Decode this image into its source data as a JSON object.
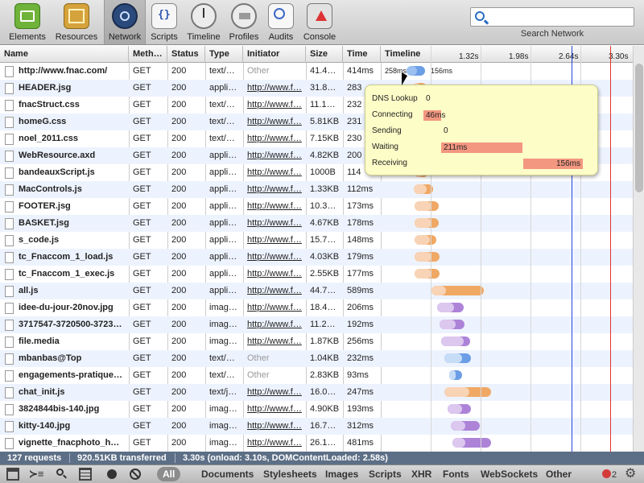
{
  "toolbar": {
    "tools": [
      "Elements",
      "Resources",
      "Network",
      "Scripts",
      "Timeline",
      "Profiles",
      "Audits",
      "Console"
    ],
    "selected": "Network"
  },
  "search": {
    "label": "Search Network",
    "value": ""
  },
  "columns": [
    "Name",
    "Meth…",
    "Status",
    "Type",
    "Initiator",
    "Size",
    "Time",
    "Timeline"
  ],
  "timeline_ticks": [
    "1.32s",
    "1.98s",
    "2.64s",
    "3.30s"
  ],
  "rows": [
    {
      "name": "http://www.fnac.com/",
      "method": "GET",
      "status": "200",
      "type": "text/…",
      "initiator": "Other",
      "size": "41.4…",
      "time": "414ms"
    },
    {
      "name": "HEADER.jsg",
      "method": "GET",
      "status": "200",
      "type": "appli…",
      "initiator": "http://www.f…",
      "size": "31.8…",
      "time": "283"
    },
    {
      "name": "fnacStruct.css",
      "method": "GET",
      "status": "200",
      "type": "text/…",
      "initiator": "http://www.f…",
      "size": "11.1…",
      "time": "232"
    },
    {
      "name": "homeG.css",
      "method": "GET",
      "status": "200",
      "type": "text/…",
      "initiator": "http://www.f…",
      "size": "5.81KB",
      "time": "231"
    },
    {
      "name": "noel_2011.css",
      "method": "GET",
      "status": "200",
      "type": "text/…",
      "initiator": "http://www.f…",
      "size": "7.15KB",
      "time": "230"
    },
    {
      "name": "WebResource.axd",
      "method": "GET",
      "status": "200",
      "type": "appli…",
      "initiator": "http://www.f…",
      "size": "4.82KB",
      "time": "200"
    },
    {
      "name": "bandeauxScript.js",
      "method": "GET",
      "status": "200",
      "type": "appli…",
      "initiator": "http://www.f…",
      "size": "1000B",
      "time": "114"
    },
    {
      "name": "MacControls.js",
      "method": "GET",
      "status": "200",
      "type": "appli…",
      "initiator": "http://www.f…",
      "size": "1.33KB",
      "time": "112ms"
    },
    {
      "name": "FOOTER.jsg",
      "method": "GET",
      "status": "200",
      "type": "appli…",
      "initiator": "http://www.f…",
      "size": "10.3…",
      "time": "173ms"
    },
    {
      "name": "BASKET.jsg",
      "method": "GET",
      "status": "200",
      "type": "appli…",
      "initiator": "http://www.f…",
      "size": "4.67KB",
      "time": "178ms"
    },
    {
      "name": "s_code.js",
      "method": "GET",
      "status": "200",
      "type": "appli…",
      "initiator": "http://www.f…",
      "size": "15.7…",
      "time": "148ms"
    },
    {
      "name": "tc_Fnaccom_1_load.js",
      "method": "GET",
      "status": "200",
      "type": "appli…",
      "initiator": "http://www.f…",
      "size": "4.03KB",
      "time": "179ms"
    },
    {
      "name": "tc_Fnaccom_1_exec.js",
      "method": "GET",
      "status": "200",
      "type": "appli…",
      "initiator": "http://www.f…",
      "size": "2.55KB",
      "time": "177ms"
    },
    {
      "name": "all.js",
      "method": "GET",
      "status": "200",
      "type": "appli…",
      "initiator": "http://www.f…",
      "size": "44.7…",
      "time": "589ms"
    },
    {
      "name": "idee-du-jour-20nov.jpg",
      "method": "GET",
      "status": "200",
      "type": "imag…",
      "initiator": "http://www.f…",
      "size": "18.4…",
      "time": "206ms"
    },
    {
      "name": "3717547-3720500-3723…",
      "method": "GET",
      "status": "200",
      "type": "imag…",
      "initiator": "http://www.f…",
      "size": "11.2…",
      "time": "192ms"
    },
    {
      "name": "file.media",
      "method": "GET",
      "status": "200",
      "type": "imag…",
      "initiator": "http://www.f…",
      "size": "1.87KB",
      "time": "256ms"
    },
    {
      "name": "mbanbas@Top",
      "method": "GET",
      "status": "200",
      "type": "text/…",
      "initiator": "Other",
      "size": "1.04KB",
      "time": "232ms"
    },
    {
      "name": "engagements-pratique…",
      "method": "GET",
      "status": "200",
      "type": "text/…",
      "initiator": "Other",
      "size": "2.83KB",
      "time": "93ms"
    },
    {
      "name": "chat_init.js",
      "method": "GET",
      "status": "200",
      "type": "text/j…",
      "initiator": "http://www.f…",
      "size": "16.0…",
      "time": "247ms"
    },
    {
      "name": "3824844bis-140.jpg",
      "method": "GET",
      "status": "200",
      "type": "imag…",
      "initiator": "http://www.f…",
      "size": "4.90KB",
      "time": "193ms"
    },
    {
      "name": "kitty-140.jpg",
      "method": "GET",
      "status": "200",
      "type": "imag…",
      "initiator": "http://www.f…",
      "size": "16.7…",
      "time": "312ms"
    },
    {
      "name": "vignette_fnacphoto_h…",
      "method": "GET",
      "status": "200",
      "type": "imag…",
      "initiator": "http://www.f…",
      "size": "26.1…",
      "time": "481ms"
    }
  ],
  "first_row_labels": {
    "left": "258ms",
    "right": "156ms"
  },
  "tooltip": [
    {
      "label": "DNS Lookup",
      "value": "0"
    },
    {
      "label": "Connecting",
      "value": "46ms"
    },
    {
      "label": "Sending",
      "value": "0"
    },
    {
      "label": "Waiting",
      "value": "211ms"
    },
    {
      "label": "Receiving",
      "value": "156ms"
    }
  ],
  "status_bar": {
    "requests": "127 requests",
    "transferred": "920.51KB transferred",
    "timing": "3.30s (onload: 3.10s, DOMContentLoaded: 2.58s)"
  },
  "filters": [
    "All",
    "Documents",
    "Stylesheets",
    "Images",
    "Scripts",
    "XHR",
    "Fonts",
    "WebSockets",
    "Other"
  ],
  "error_count": "2",
  "colors": {
    "blue_line": "#2845d8",
    "red_line": "#e23232",
    "status_bar": "#5d6f86"
  }
}
